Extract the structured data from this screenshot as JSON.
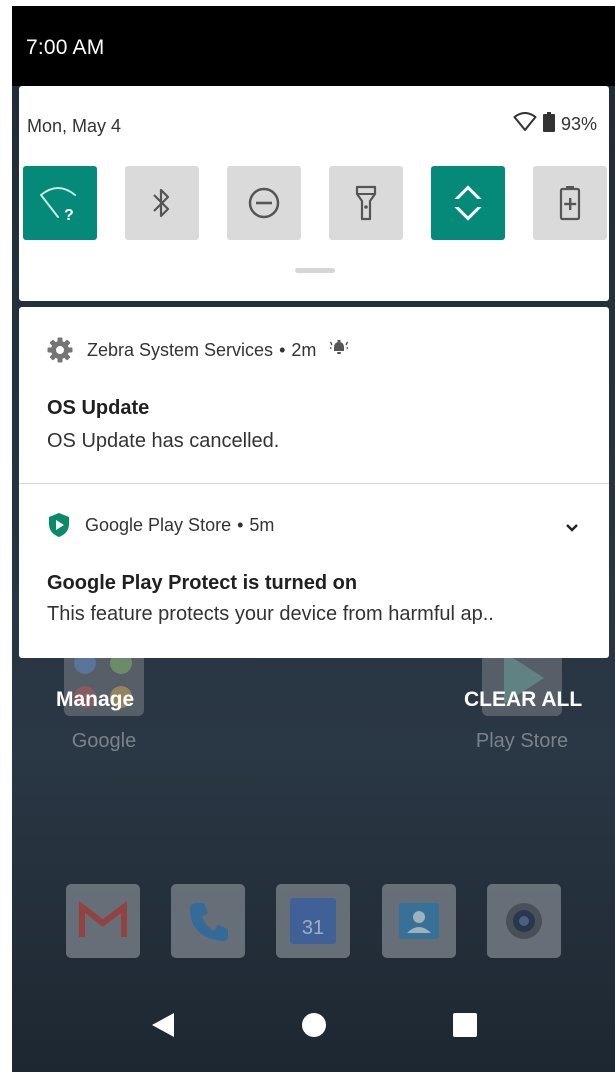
{
  "status_bar": {
    "time": "7:00 AM"
  },
  "quick_settings": {
    "date": "Mon, May 4",
    "battery_percent": "93%",
    "tiles": [
      {
        "name": "wifi",
        "active": true
      },
      {
        "name": "bluetooth",
        "active": false
      },
      {
        "name": "do-not-disturb",
        "active": false
      },
      {
        "name": "flashlight",
        "active": false
      },
      {
        "name": "auto-rotate",
        "active": true
      },
      {
        "name": "battery-saver",
        "active": false
      }
    ],
    "wifi_badge": "?"
  },
  "notifications": [
    {
      "app": "Zebra System Services",
      "time": "2m",
      "separator": "•",
      "title": "OS Update",
      "text": "OS Update has cancelled.",
      "icon": "gear-icon"
    },
    {
      "app": "Google Play Store",
      "time": "5m",
      "separator": "•",
      "title": "Google Play Protect is turned on",
      "text": "This feature protects your device from harmful ap..",
      "icon": "play-protect-shield-icon"
    }
  ],
  "actions": {
    "manage": "Manage",
    "clear_all": "CLEAR ALL"
  },
  "home": {
    "apps": [
      {
        "label": "Google"
      },
      {
        "label": "Play Store"
      }
    ],
    "dock": [
      {
        "name": "gmail"
      },
      {
        "name": "phone"
      },
      {
        "name": "calendar",
        "day": "31"
      },
      {
        "name": "contacts"
      },
      {
        "name": "camera"
      }
    ]
  },
  "colors": {
    "accent": "#058a7a",
    "tile_off": "#dadada",
    "status_bar": "#000000"
  }
}
